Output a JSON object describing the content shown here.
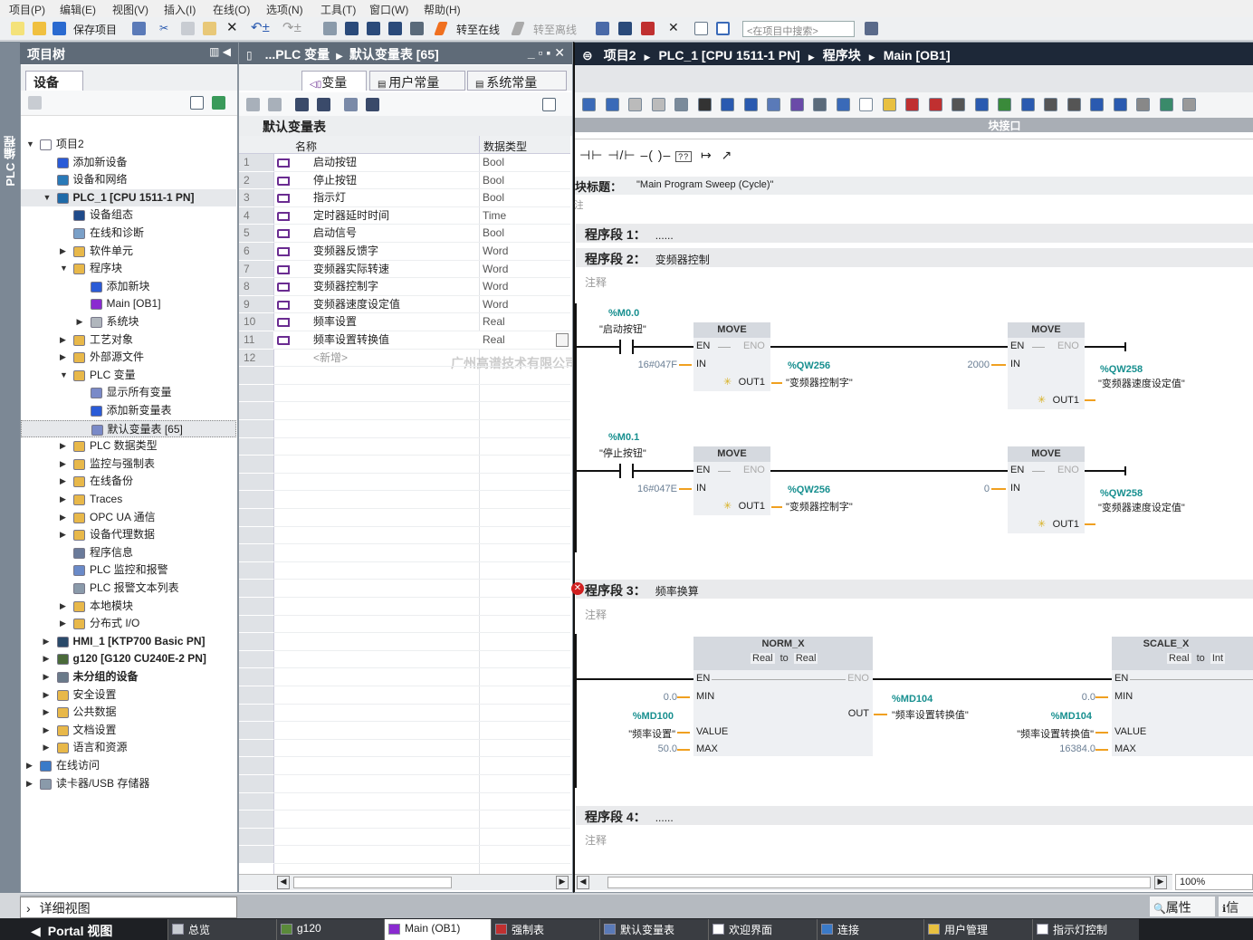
{
  "menu": [
    "项目(P)",
    "编辑(E)",
    "视图(V)",
    "插入(I)",
    "在线(O)",
    "选项(N)",
    "工具(T)",
    "窗口(W)",
    "帮助(H)"
  ],
  "toolbar": {
    "save": "保存项目",
    "go_online": "转至在线",
    "go_offline": "转至离线",
    "search_placeholder": "<在项目中搜索>"
  },
  "side_strip": "PLC 编程",
  "tree": {
    "title": "项目树",
    "tab": "设备",
    "items": [
      {
        "label": "项目2",
        "lvl": 0,
        "exp": "open",
        "color": "#ffffff"
      },
      {
        "label": "添加新设备",
        "lvl": 1,
        "color": "#2a5bd7"
      },
      {
        "label": "设备和网络",
        "lvl": 1,
        "color": "#2a7ab8"
      },
      {
        "label": "PLC_1 [CPU 1511-1 PN]",
        "lvl": 1,
        "exp": "open",
        "color": "#1e6aa8",
        "hl": true
      },
      {
        "label": "设备组态",
        "lvl": 2,
        "color": "#1f4a8a"
      },
      {
        "label": "在线和诊断",
        "lvl": 2,
        "color": "#7aa0c8"
      },
      {
        "label": "软件单元",
        "lvl": 2,
        "exp": "closed",
        "color": "#e8b84a"
      },
      {
        "label": "程序块",
        "lvl": 2,
        "exp": "open",
        "color": "#e8b84a"
      },
      {
        "label": "添加新块",
        "lvl": 3,
        "color": "#2a5bd7"
      },
      {
        "label": "Main [OB1]",
        "lvl": 3,
        "color": "#8a2ad0"
      },
      {
        "label": "系统块",
        "lvl": 3,
        "exp": "closed",
        "color": "#b0b6bd"
      },
      {
        "label": "工艺对象",
        "lvl": 2,
        "exp": "closed",
        "color": "#e8b84a"
      },
      {
        "label": "外部源文件",
        "lvl": 2,
        "exp": "closed",
        "color": "#e8b84a"
      },
      {
        "label": "PLC 变量",
        "lvl": 2,
        "exp": "open",
        "color": "#e8b84a"
      },
      {
        "label": "显示所有变量",
        "lvl": 3,
        "color": "#7a8ac8"
      },
      {
        "label": "添加新变量表",
        "lvl": 3,
        "color": "#2a5bd7"
      },
      {
        "label": "默认变量表 [65]",
        "lvl": 3,
        "color": "#7a8ac8",
        "sel": true
      },
      {
        "label": "PLC 数据类型",
        "lvl": 2,
        "exp": "closed",
        "color": "#e8b84a"
      },
      {
        "label": "监控与强制表",
        "lvl": 2,
        "exp": "closed",
        "color": "#e8b84a"
      },
      {
        "label": "在线备份",
        "lvl": 2,
        "exp": "closed",
        "color": "#e8b84a"
      },
      {
        "label": "Traces",
        "lvl": 2,
        "exp": "closed",
        "color": "#e8b84a"
      },
      {
        "label": "OPC UA 通信",
        "lvl": 2,
        "exp": "closed",
        "color": "#e8b84a"
      },
      {
        "label": "设备代理数据",
        "lvl": 2,
        "exp": "closed",
        "color": "#e8b84a"
      },
      {
        "label": "程序信息",
        "lvl": 2,
        "color": "#6a7a9a"
      },
      {
        "label": "PLC 监控和报警",
        "lvl": 2,
        "color": "#6a8ac8"
      },
      {
        "label": "PLC 报警文本列表",
        "lvl": 2,
        "color": "#8a9aaa"
      },
      {
        "label": "本地模块",
        "lvl": 2,
        "exp": "closed",
        "color": "#e8b84a"
      },
      {
        "label": "分布式 I/O",
        "lvl": 2,
        "exp": "closed",
        "color": "#e8b84a"
      },
      {
        "label": "HMI_1 [KTP700 Basic PN]",
        "lvl": 1,
        "exp": "closed",
        "color": "#2a4a6a",
        "bold": true
      },
      {
        "label": "g120 [G120 CU240E-2 PN]",
        "lvl": 1,
        "exp": "closed",
        "color": "#4a6a3a",
        "bold": true
      },
      {
        "label": "未分组的设备",
        "lvl": 1,
        "exp": "closed",
        "color": "#6a7a8a",
        "bold": true
      },
      {
        "label": "安全设置",
        "lvl": 1,
        "exp": "closed",
        "color": "#e8b84a"
      },
      {
        "label": "公共数据",
        "lvl": 1,
        "exp": "closed",
        "color": "#e8b84a"
      },
      {
        "label": "文档设置",
        "lvl": 1,
        "exp": "closed",
        "color": "#e8b84a"
      },
      {
        "label": "语言和资源",
        "lvl": 1,
        "exp": "closed",
        "color": "#e8b84a"
      },
      {
        "label": "在线访问",
        "lvl": 0,
        "exp": "closed",
        "color": "#3a7ac8"
      },
      {
        "label": "读卡器/USB 存储器",
        "lvl": 0,
        "exp": "closed",
        "color": "#8a9aaa"
      }
    ]
  },
  "vars": {
    "breadcrumb": [
      "...PLC 变量",
      "默认变量表 [65]"
    ],
    "tabs": [
      "变量",
      "用户常量",
      "系统常量"
    ],
    "table_title": "默认变量表",
    "col_name": "名称",
    "col_type": "数据类型",
    "rows": [
      {
        "n": "1",
        "name": "启动按钮",
        "type": "Bool"
      },
      {
        "n": "2",
        "name": "停止按钮",
        "type": "Bool"
      },
      {
        "n": "3",
        "name": "指示灯",
        "type": "Bool"
      },
      {
        "n": "4",
        "name": "定时器延时时间",
        "type": "Time"
      },
      {
        "n": "5",
        "name": "启动信号",
        "type": "Bool"
      },
      {
        "n": "6",
        "name": "变频器反馈字",
        "type": "Word"
      },
      {
        "n": "7",
        "name": "变频器实际转速",
        "type": "Word"
      },
      {
        "n": "8",
        "name": "变频器控制字",
        "type": "Word"
      },
      {
        "n": "9",
        "name": "变频器速度设定值",
        "type": "Word"
      },
      {
        "n": "10",
        "name": "频率设置",
        "type": "Real"
      },
      {
        "n": "11",
        "name": "频率设置转换值",
        "type": "Real"
      }
    ],
    "add_row": {
      "n": "12",
      "name": "<新增>"
    }
  },
  "watermark": "广州高谱技术有限公司 版权所有",
  "editor": {
    "breadcrumb": [
      "项目2",
      "PLC_1 [CPU 1511-1 PN]",
      "程序块",
      "Main [OB1]"
    ],
    "interface_label": "块接口",
    "block_title_label": "块标题：",
    "block_title": "\"Main Program Sweep (Cycle)\"",
    "block_comment": "注释",
    "zoom": "100%"
  },
  "networks": [
    {
      "label": "程序段 1：",
      "title": "......"
    },
    {
      "label": "程序段 2：",
      "title": "变频器控制",
      "comment": "注释"
    },
    {
      "label": "程序段 3：",
      "title": "频率换算",
      "comment": "注释",
      "error": true
    },
    {
      "label": "程序段 4：",
      "title": "......",
      "comment": "注释"
    }
  ],
  "pins": {
    "en": "EN",
    "eno": "ENO",
    "in": "IN",
    "out1": "OUT1",
    "min": "MIN",
    "value": "VALUE",
    "max": "MAX",
    "out": "OUT"
  },
  "net2": [
    {
      "contact_addr": "%M0.0",
      "contact_name": "\"启动按钮\"",
      "move": "MOVE",
      "in1": "16#047F",
      "out1_addr": "%QW256",
      "out1_name": "\"变频器控制字\"",
      "in2": "2000",
      "out2_addr": "%QW258",
      "out2_name": "\"变频器速度设定值\""
    },
    {
      "contact_addr": "%M0.1",
      "contact_name": "\"停止按钮\"",
      "move": "MOVE",
      "in1": "16#047E",
      "out1_addr": "%QW256",
      "out1_name": "\"变频器控制字\"",
      "in2": "0",
      "out2_addr": "%QW258",
      "out2_name": "\"变频器速度设定值\""
    }
  ],
  "net3": {
    "norm": {
      "name": "NORM_X",
      "from": "Real",
      "to_word": "to",
      "to": "Real",
      "min": "0.0",
      "value_addr": "%MD100",
      "value_name": "\"频率设置\"",
      "max": "50.0",
      "out_addr": "%MD104",
      "out_name": "\"频率设置转换值\""
    },
    "scale": {
      "name": "SCALE_X",
      "from": "Real",
      "to_word": "to",
      "to": "Int",
      "min": "0.0",
      "value_addr": "%MD104",
      "value_name": "\"频率设置转换值\"",
      "max": "16384.0"
    }
  },
  "bottom": {
    "detail_view": "详细视图",
    "properties": "属性",
    "info": "信"
  },
  "taskbar": {
    "portal": "Portal 视图",
    "items": [
      "总览",
      "g120",
      "Main (OB1)",
      "强制表",
      "默认变量表",
      "欢迎界面",
      "连接",
      "用户管理",
      "指示灯控制"
    ],
    "active": 2
  }
}
